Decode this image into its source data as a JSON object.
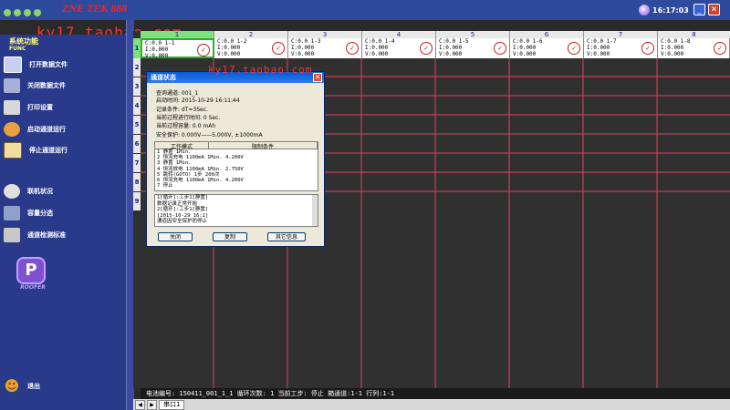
{
  "app": {
    "logo_text": "ZNE TEK 888",
    "watermark": "ky17.taobao.com",
    "clock": "16:17:03",
    "min_glyph": "_",
    "close_glyph": "✕"
  },
  "sidebar": {
    "title_line1": "系统功能",
    "title_line2": "FUNC",
    "items": [
      {
        "label": "打开数据文件",
        "icon": "folder-icon"
      },
      {
        "label": "关闭数据文件",
        "icon": "close-file-icon"
      },
      {
        "label": "打印设置",
        "icon": "printer-icon"
      },
      {
        "label": "启动通道运行",
        "icon": "run-icon"
      },
      {
        "label": "停止通道运行",
        "icon": "stop-icon"
      },
      {
        "label": "联机状况",
        "icon": "globe-icon"
      },
      {
        "label": "容量分选",
        "icon": "sort-icon"
      },
      {
        "label": "通道检测标准",
        "icon": "tools-icon"
      },
      {
        "label": "退出",
        "icon": "exit-icon"
      }
    ],
    "brand_logo": "ROOFER"
  },
  "grid": {
    "columns": [
      "1",
      "2",
      "3",
      "4",
      "5",
      "6",
      "7",
      "8"
    ],
    "rows": [
      "1",
      "2",
      "3",
      "4",
      "5",
      "6",
      "7",
      "8",
      "9"
    ],
    "cells": [
      {
        "c": "C:0.0 1-1",
        "i": "I:0.000",
        "v": "V:0.000"
      },
      {
        "c": "C:0.0 1-2",
        "i": "I:0.000",
        "v": "V:0.000"
      },
      {
        "c": "C:0.0 1-3",
        "i": "I:0.000",
        "v": "V:0.000"
      },
      {
        "c": "C:0.0 1-4",
        "i": "I:0.000",
        "v": "V:0.000"
      },
      {
        "c": "C:0.0 1-5",
        "i": "I:0.000",
        "v": "V:0.000"
      },
      {
        "c": "C:0.0 1-6",
        "i": "I:0.000",
        "v": "V:0.000"
      },
      {
        "c": "C:0.0 1-7",
        "i": "I:0.000",
        "v": "V:0.000"
      },
      {
        "c": "C:0.0 1-8",
        "i": "I:0.000",
        "v": "V:0.000"
      }
    ],
    "ok_glyph": "✓"
  },
  "dialog": {
    "title": "通道状态",
    "close_glyph": "✕",
    "lines": [
      "查询通道: 001_1",
      "启动时间: 2015-10-29 16:11:44",
      "记录条件: dT=3Sec.",
      "当前过程进行时间: 0 Sec.",
      "当前过程容量: 0.0 mAh",
      "安全保护: 0.000V——5.000V, ±1000mA"
    ],
    "steps_header": [
      "工作模式",
      "限制条件"
    ],
    "steps": [
      "1  静置 1Min.",
      "2  恒流充电 1100mA 1Min.      4.200V",
      "3  静置 1Min.",
      "4  恒流放电 1100mA 1Min.      2.750V",
      "5  跳转(GOTO) 1步  200次",
      "6  恒流充电 1100mA 1Min.      4.200V",
      "7  停止"
    ],
    "log": [
      "1[循环]:工步1[静置]",
      "  数据记录正常开始",
      "2[循环]:工步1[静置]",
      "  [2015-10-29 16:1]",
      "  通道因安全保护而停止"
    ],
    "buttons": {
      "close": "关闭",
      "copy": "复制",
      "other": "其它信息"
    }
  },
  "status": {
    "text": "电池编号: 150411_001_1_1 循环次数: 1 当前工步: 停止 箱通道:1-1 行列:1-1"
  },
  "tabs": {
    "prev": "◀",
    "next": "▶",
    "serial": "串口1"
  }
}
